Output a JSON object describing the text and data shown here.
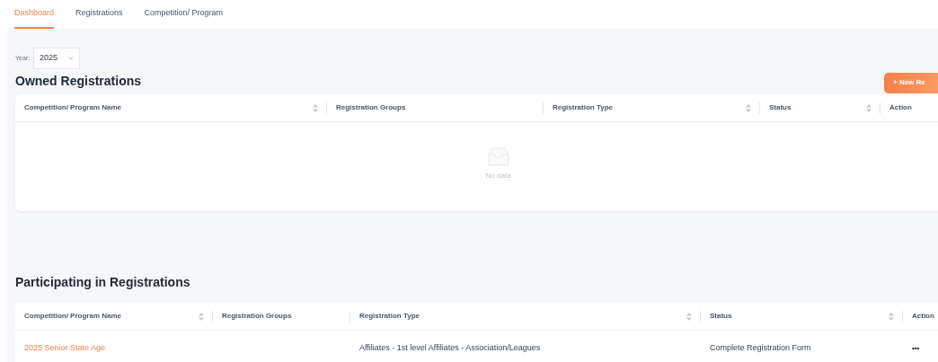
{
  "tabs": [
    {
      "label": "Dashboard",
      "selected": true
    },
    {
      "label": "Registrations",
      "selected": false
    },
    {
      "label": "Competition/ Program",
      "selected": false
    }
  ],
  "year": {
    "label": "Year:",
    "value": "2025"
  },
  "owned": {
    "title": "Owned Registrations",
    "new_button": "+ New Re",
    "columns": [
      {
        "label": "Competition/ Program Name",
        "sortable": true
      },
      {
        "label": "Registration Groups",
        "sortable": false
      },
      {
        "label": "Registration Type",
        "sortable": true
      },
      {
        "label": "Status",
        "sortable": true
      },
      {
        "label": "Action"
      }
    ],
    "empty_text": "No data"
  },
  "participating": {
    "title": "Participating in Registrations",
    "columns": [
      {
        "label": "Competition/ Program Name",
        "sortable": true
      },
      {
        "label": "Registration Groups",
        "sortable": false
      },
      {
        "label": "Registration Type",
        "sortable": true
      },
      {
        "label": "Status",
        "sortable": true
      },
      {
        "label": "Action"
      }
    ],
    "rows": [
      {
        "name": "2025 Senior State Age",
        "type": "Affiliates - 1st level Affiliates - Association/Leagues",
        "status": "Complete Registration Form",
        "action": "•••"
      }
    ]
  }
}
